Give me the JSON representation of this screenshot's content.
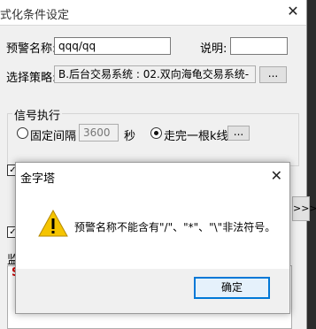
{
  "window": {
    "title": "式化条件设定",
    "close_glyph": "✕"
  },
  "form": {
    "alert_name_label": "预警名称:",
    "alert_name_value": "qqq/qq",
    "desc_label": "说明:",
    "desc_value": "",
    "strategy_label": "选择策略:",
    "strategy_value": "B.后台交易系统 : 02.双向海龟交易系统-",
    "browse_label": "...",
    "signal_group_title": "信号执行",
    "fixed_interval_label": "固定间隔",
    "interval_value": "3600",
    "seconds_label": "秒",
    "bar_complete_label": "走完一根k线",
    "bar_more_label": "...",
    "side_arrow_label": ">>>",
    "list_partial_label": "监",
    "list_first_char": "S"
  },
  "dialog": {
    "title": "金字塔",
    "close_glyph": "✕",
    "message": "预警名称不能含有\"/\"、\"*\"、\"\\\"非法符号。",
    "ok_label": "确定",
    "icon": "warning-icon",
    "icon_color": "#f5c400"
  }
}
